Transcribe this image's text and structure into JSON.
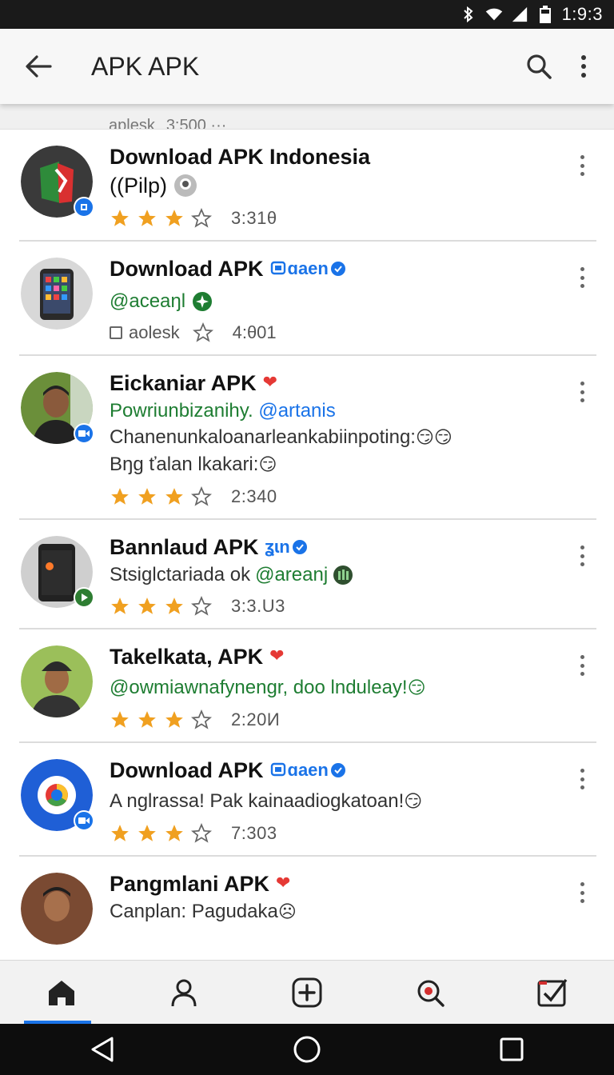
{
  "status_bar": {
    "time": "1:9:3",
    "icons": [
      "bluetooth-icon",
      "wifi-icon",
      "signal-icon",
      "battery-icon"
    ]
  },
  "app_bar": {
    "title": "APK APK",
    "back_icon": "arrow-left-icon",
    "search_icon": "search-icon",
    "more_icon": "more-vert-icon"
  },
  "peek_row": {
    "label": "aplesk",
    "count": "3:500 ···"
  },
  "items": [
    {
      "name": "Download APK Indonesia",
      "second_line": "((Pilp)",
      "rating_stars": 3,
      "rating_max": 4,
      "count": "3:31θ"
    },
    {
      "name": "Download APK",
      "verified": "ɑaen",
      "handle": "@aceaŋl",
      "meta_label": "aolesk",
      "count": "4:θ01"
    },
    {
      "name": "Eickaniar APK",
      "tagline": "Powriunbizanihy.",
      "tagline_handle": "@artanis",
      "desc1": "Chanenunkaloanarleankabiinpoting:",
      "desc2": "Bŋg ťalan lkakari:",
      "rating_stars": 3,
      "rating_max": 4,
      "count": "2:340"
    },
    {
      "name": "Bannlaud APK",
      "verified": "ʓɩn",
      "desc1": "Stsiglctariada ok",
      "desc1_handle": "@areanj",
      "rating_stars": 3,
      "rating_max": 4,
      "count": "3:3.U3"
    },
    {
      "name": "Takelkata, APK",
      "tagline": "@owmiawnafynengr, doo lnduleay!",
      "rating_stars": 3,
      "rating_max": 4,
      "count": "2:20И"
    },
    {
      "name": "Download APK",
      "verified": "ɑaen",
      "desc1": "A nglrassa! Pak kainaadiogkatoan!",
      "rating_stars": 3,
      "rating_max": 4,
      "count": "7:303"
    },
    {
      "name": "Pangmlani APK",
      "desc1": "Canplan: Pagudaka"
    }
  ],
  "bottom_nav": [
    {
      "icon": "home-icon",
      "active": true
    },
    {
      "icon": "profile-icon",
      "active": false
    },
    {
      "icon": "add-box-icon",
      "active": false
    },
    {
      "icon": "search-location-icon",
      "active": false
    },
    {
      "icon": "checkbox-icon",
      "active": false
    }
  ],
  "system_nav": [
    "back-triangle-icon",
    "home-circle-icon",
    "recents-square-icon"
  ],
  "colors": {
    "star": "#f0a020",
    "accent": "#1a73e8",
    "green_text": "#1e7d32"
  }
}
